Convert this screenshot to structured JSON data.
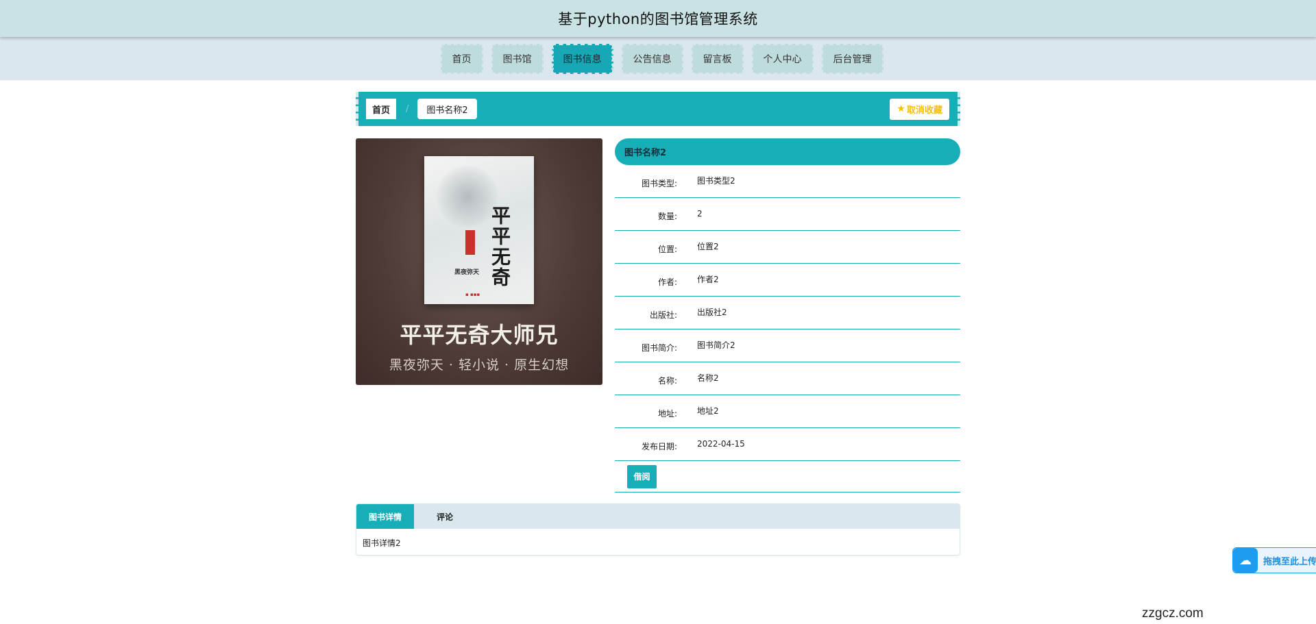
{
  "header": {
    "title": "基于python的图书馆管理系统"
  },
  "nav": {
    "items": [
      {
        "label": "首页"
      },
      {
        "label": "图书馆"
      },
      {
        "label": "图书信息",
        "active": true
      },
      {
        "label": "公告信息"
      },
      {
        "label": "留言板"
      },
      {
        "label": "个人中心"
      },
      {
        "label": "后台管理"
      }
    ]
  },
  "breadcrumb": {
    "home": "首页",
    "separator": "/",
    "current": "图书名称2",
    "favorite_label": "取消收藏"
  },
  "cover": {
    "vertical_title": "平平无奇",
    "author_line": "黑夜弥天",
    "title": "平平无奇大师兄",
    "subtitle": "黑夜弥天 · 轻小说 · 原生幻想"
  },
  "book": {
    "name": "图书名称2",
    "fields": [
      {
        "label": "图书类型:",
        "value": "图书类型2"
      },
      {
        "label": "数量:",
        "value": "2"
      },
      {
        "label": "位置:",
        "value": "位置2"
      },
      {
        "label": "作者:",
        "value": "作者2"
      },
      {
        "label": "出版社:",
        "value": "出版社2"
      },
      {
        "label": "图书简介:",
        "value": "图书简介2"
      },
      {
        "label": "名称:",
        "value": "名称2"
      },
      {
        "label": "地址:",
        "value": "地址2"
      },
      {
        "label": "发布日期:",
        "value": "2022-04-15"
      }
    ],
    "borrow_label": "借阅"
  },
  "tabs": {
    "items": [
      {
        "label": "图书详情",
        "active": true
      },
      {
        "label": "评论"
      }
    ],
    "content": "图书详情2"
  },
  "upload_widget": {
    "label": "拖拽至此上传",
    "icon": "cloud-upload-icon"
  },
  "watermark": "zzgcz.com",
  "colors": {
    "accent": "#17aeb8",
    "header_bg": "#c9e2e3",
    "nav_bg": "#dae7ef",
    "favorite": "#f5c000"
  }
}
